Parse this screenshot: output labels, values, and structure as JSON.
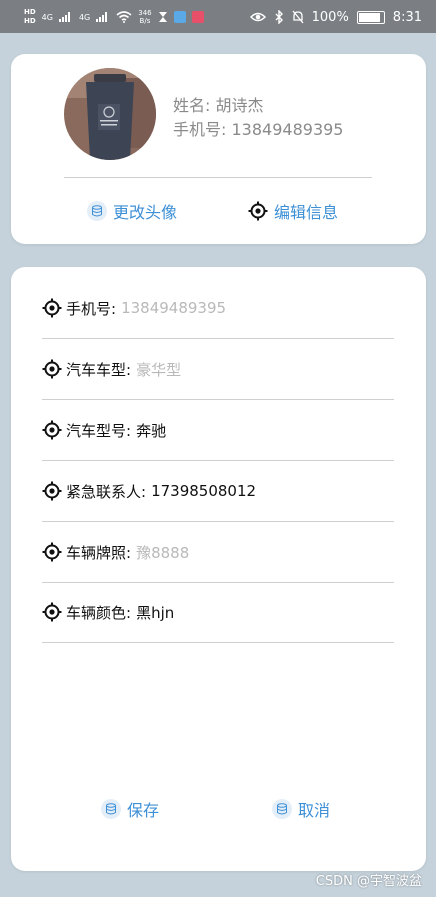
{
  "status_bar": {
    "hd_top": "HD",
    "hd_bottom": "HD",
    "net1": "4G",
    "net2": "4G",
    "speed_value": "346",
    "speed_unit": "B/s",
    "battery": "100%",
    "time": "8:31"
  },
  "profile": {
    "name_label": "姓名:",
    "name_value": "胡诗杰",
    "phone_label": "手机号:",
    "phone_value": "13849489395",
    "change_avatar": "更改头像",
    "edit_info": "编辑信息"
  },
  "fields": [
    {
      "label": "手机号:",
      "value": "13849489395",
      "placeholder": true
    },
    {
      "label": "汽车车型:",
      "value": "豪华型",
      "placeholder": true
    },
    {
      "label": "汽车型号:",
      "value": "奔驰",
      "placeholder": false
    },
    {
      "label": "紧急联系人:",
      "value": "17398508012",
      "placeholder": false
    },
    {
      "label": "车辆牌照:",
      "value": "豫8888",
      "placeholder": true
    },
    {
      "label": "车辆颜色:",
      "value": "黑hjn",
      "placeholder": false
    }
  ],
  "buttons": {
    "save": "保存",
    "cancel": "取消"
  },
  "watermark": "CSDN @宇智波盆",
  "colors": {
    "background": "#c5d2db",
    "accent": "#3d8fd6",
    "placeholder": "#b9b9b9"
  },
  "icons": [
    "database-icon",
    "target-icon",
    "eye-icon",
    "bluetooth-icon",
    "mute-icon",
    "battery-icon",
    "wifi-icon"
  ]
}
